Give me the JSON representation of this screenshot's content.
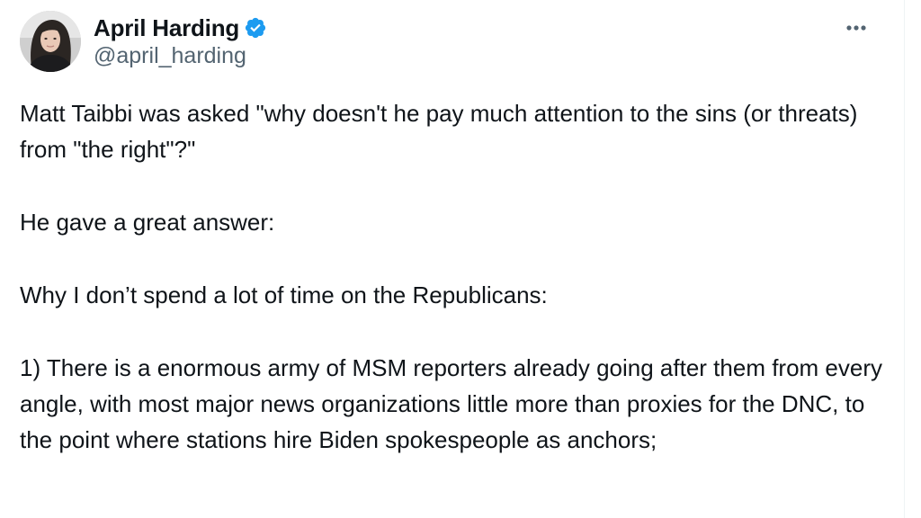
{
  "author": {
    "display_name": "April Harding",
    "handle": "@april_harding",
    "verified": true,
    "verified_color": "#1d9bf0"
  },
  "menu": {
    "icon": "more-horizontal-icon"
  },
  "tweet": {
    "paragraphs": [
      "Matt Taibbi was asked \"why doesn't he pay much attention to the sins (or threats) from \"the right\"?\"",
      "He gave a great answer:",
      "Why I don’t spend a lot of time on the Republicans:",
      "1) There is a enormous army of MSM reporters already going after them from every angle, with most major news organizations little more than proxies for the DNC, to the point where stations hire Biden spokespeople as anchors;"
    ]
  },
  "colors": {
    "text": "#0f1419",
    "secondary_text": "#536471",
    "accent": "#1d9bf0"
  }
}
